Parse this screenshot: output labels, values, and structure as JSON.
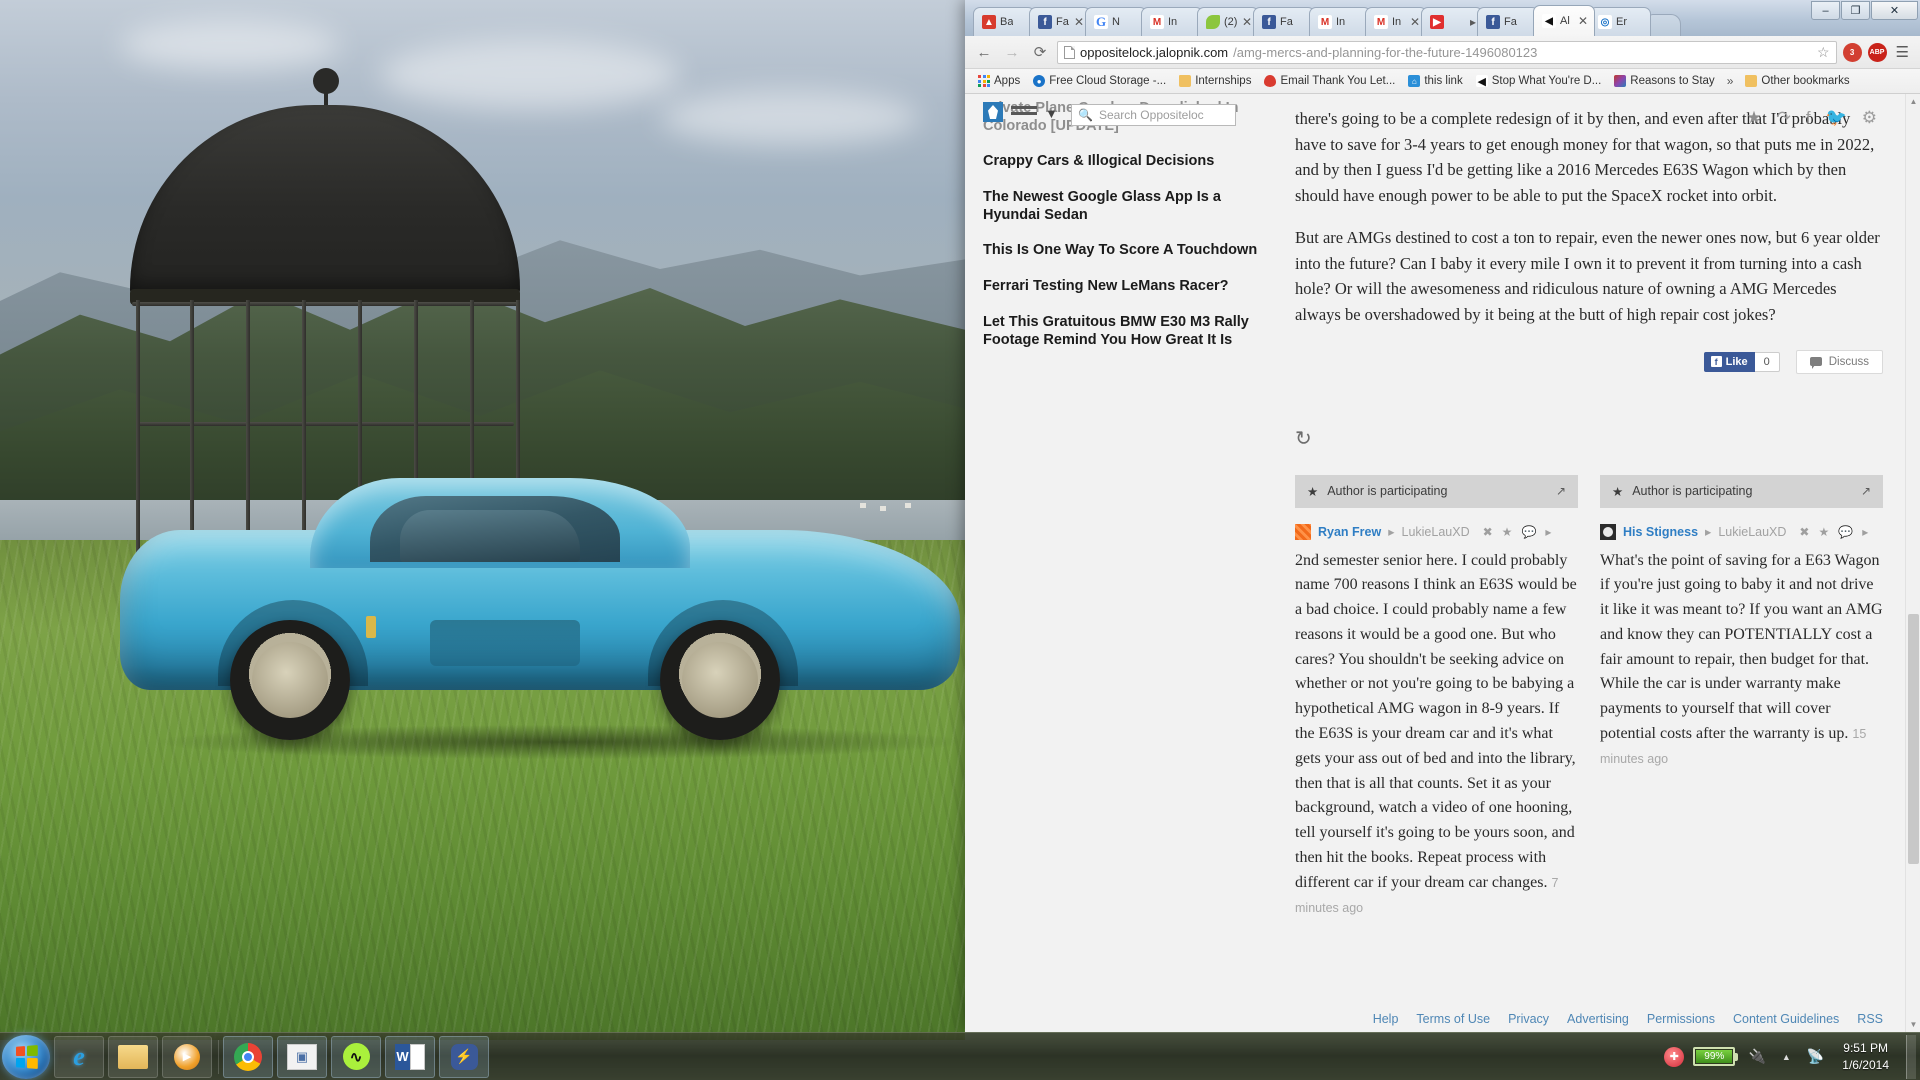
{
  "desktop": {
    "wallpaper_description": "blue-classic-sports-car-on-grass-with-gazebo-and-mountains"
  },
  "browser": {
    "tabs": [
      {
        "label": "Ba",
        "icon": "battery-site-icon",
        "favicon_class": "fav-bat",
        "closable": false,
        "active": false
      },
      {
        "label": "Fa",
        "icon": "facebook-icon",
        "favicon_class": "fav-fb",
        "closable": true,
        "active": false
      },
      {
        "label": "N",
        "icon": "google-icon",
        "favicon_class": "fav-g",
        "closable": false,
        "active": false
      },
      {
        "label": "In",
        "icon": "gmail-icon",
        "favicon_class": "fav-m",
        "closable": false,
        "active": false
      },
      {
        "label": "(2)",
        "icon": "evernote-leaf-icon",
        "favicon_class": "fav-leaf",
        "closable": true,
        "active": false
      },
      {
        "label": "Fa",
        "icon": "facebook-icon",
        "favicon_class": "fav-fb",
        "closable": false,
        "active": false
      },
      {
        "label": "In",
        "icon": "gmail-icon",
        "favicon_class": "fav-m",
        "closable": false,
        "active": false
      },
      {
        "label": "In",
        "icon": "gmail-icon",
        "favicon_class": "fav-m",
        "closable": true,
        "active": false
      },
      {
        "label": "",
        "icon": "youtube-icon",
        "favicon_class": "fav-yt",
        "closable": false,
        "active": false
      },
      {
        "label": "Fa",
        "icon": "facebook-icon",
        "favicon_class": "fav-fb",
        "closable": false,
        "active": false
      },
      {
        "label": "Al",
        "icon": "jalopnik-icon",
        "favicon_class": "fav-jal",
        "closable": true,
        "active": true
      },
      {
        "label": "Er",
        "icon": "rss-feed-icon",
        "favicon_class": "fav-ev",
        "closable": false,
        "active": false
      }
    ],
    "window_controls": {
      "minimize": "–",
      "maximize": "❐",
      "close": "✕"
    },
    "toolbar": {
      "back": "←",
      "forward": "→",
      "reload": "⟳",
      "url_strong": "oppositelock.jalopnik.com",
      "url_rest": "/amg-mercs-and-planning-for-the-future-1496080123",
      "bookmark_star": "☆",
      "ext_ghost_label": "3",
      "ext_abp_label": "ABP",
      "menu": "☰"
    },
    "bookmarks": [
      {
        "label": "Apps",
        "icon": "apps-grid-icon"
      },
      {
        "label": "Free Cloud Storage -...",
        "icon": "cloud-storage-icon"
      },
      {
        "label": "Internships",
        "icon": "folder-icon"
      },
      {
        "label": "Email Thank You Let...",
        "icon": "red-balloon-icon"
      },
      {
        "label": "this link",
        "icon": "blue-home-icon"
      },
      {
        "label": "Stop What You're D...",
        "icon": "jalopnik-icon"
      },
      {
        "label": "Reasons to Stay",
        "icon": "photo-icon"
      }
    ],
    "bookmarks_overflow": "»",
    "other_bookmarks": {
      "label": "Other bookmarks",
      "icon": "folder-icon"
    }
  },
  "page": {
    "search": {
      "placeholder": "Search Oppositeloc",
      "icon": "search-icon"
    },
    "sidebar_articles": [
      "Private Plane Crashes Demolished In Colorado [UPDATE]",
      "Crappy Cars & Illogical Decisions",
      "The Newest Google Glass App Is a Hyundai Sedan",
      "This Is One Way To Score A Touchdown",
      "Ferrari Testing New LeMans Racer?",
      "Let This Gratuitous BMW E30 M3 Rally Footage Remind You How Great It Is"
    ],
    "article_paragraphs": [
      "there's going to be a complete redesign of it by then, and even after that I'd probably have to save for 3-4 years to get enough money for that wagon, so that puts me in 2022, and by then I guess I'd be getting like a 2016 Mercedes E63S Wagon which by then should have enough power to be able to put the SpaceX rocket into orbit.",
      "But are AMGs destined to cost a ton to repair, even the newer ones now, but 6 year older into the future? Can I baby it every mile I own it to prevent it from turning into a cash hole? Or will the awesomeness and ridiculous nature of owning a AMG Mercedes always be overshadowed by it being at the butt of high repair cost jokes?"
    ],
    "share_icons": [
      "star-icon",
      "share-icon",
      "facebook-icon",
      "twitter-icon",
      "gear-icon"
    ],
    "social": {
      "like_label": "Like",
      "like_count": "0",
      "discuss_label": "Discuss"
    },
    "refresh_icon": "refresh-icon",
    "comments": [
      {
        "participating_label": "Author is participating",
        "participating_icon": "star-icon",
        "expand_icon": "expand-icon",
        "author": "Ryan Frew",
        "reply_arrow": "▸",
        "reply_to": "LukieLauXD",
        "actions": [
          "dismiss-icon",
          "star-icon",
          "reply-icon",
          "more-icon"
        ],
        "body": "2nd semester senior here. I could probably name 700 reasons I think an E63S would be a bad choice. I could probably name a few reasons it would be a good one. But who cares? You shouldn't be seeking advice on whether or not you're going to be babying a hypothetical AMG wagon in 8-9 years. If the E63S is your dream car and it's what gets your ass out of bed and into the library, then that is all that counts. Set it as your background, watch a video of one hooning, tell yourself it's going to be yours soon, and then hit the books. Repeat process with different car if your dream car changes.",
        "time": "7 minutes ago"
      },
      {
        "participating_label": "Author is participating",
        "participating_icon": "star-icon",
        "expand_icon": "expand-icon",
        "author": "His Stigness",
        "reply_arrow": "▸",
        "reply_to": "LukieLauXD",
        "actions": [
          "dismiss-icon",
          "star-icon",
          "reply-icon",
          "more-icon"
        ],
        "body": "What's the point of saving for a E63 Wagon if you're just going to baby it and not drive it like it was meant to? If you want an AMG and know they can POTENTIALLY cost a fair amount to repair, then budget for that. While the car is under warranty make payments to yourself that will cover potential costs after the warranty is up.",
        "time": "15 minutes ago"
      }
    ],
    "footer_links": [
      "Help",
      "Terms of Use",
      "Privacy",
      "Advertising",
      "Permissions",
      "Content Guidelines",
      "RSS"
    ]
  },
  "taskbar": {
    "start_label": "start-orb",
    "items": [
      {
        "name": "internet-explorer",
        "pinned": true,
        "running": false
      },
      {
        "name": "windows-explorer",
        "pinned": true,
        "running": false
      },
      {
        "name": "windows-media-player",
        "pinned": true,
        "running": false
      },
      {
        "name": "google-chrome",
        "pinned": false,
        "running": true
      },
      {
        "name": "itch-app",
        "pinned": false,
        "running": true
      },
      {
        "name": "spotify",
        "pinned": false,
        "running": true
      },
      {
        "name": "microsoft-word",
        "pinned": false,
        "running": true
      },
      {
        "name": "facebook-messenger",
        "pinned": false,
        "running": true
      }
    ],
    "tray": {
      "notification_icon": "red-shield-icon",
      "battery_percent": "99%",
      "power_icon": "power-plug-icon",
      "show_hidden_icon": "▲",
      "network_icon": "network-icon",
      "time": "9:51 PM",
      "date": "1/6/2014"
    }
  },
  "colors": {
    "chrome_tabstrip": "#b6c6d8",
    "link_blue": "#2f7ec4",
    "facebook_blue": "#3b5998",
    "footer_link": "#4f87b5",
    "car_blue": "#3aa6cd"
  }
}
